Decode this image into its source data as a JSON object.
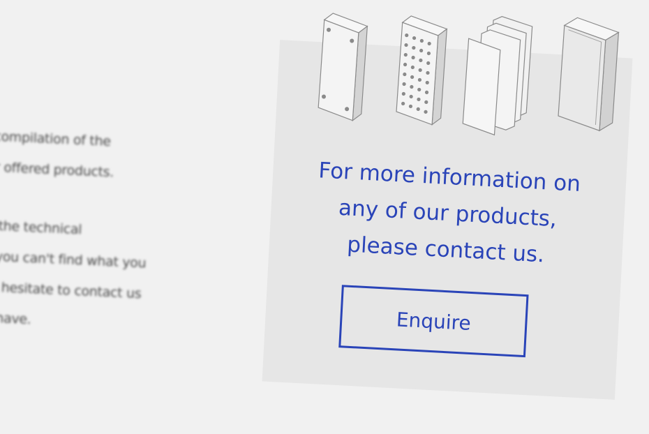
{
  "left_copy": {
    "lines": [
      "s a compilation of the",
      "f our offered products.",
      "n all the technical",
      "er if you can't find what you",
      "don't hesitate to contact us",
      "may have."
    ]
  },
  "card": {
    "message_lines": [
      "For more information on",
      "any of our products,",
      "please contact us."
    ],
    "button_label": "Enquire",
    "accent_color": "#2a44b8",
    "icons": [
      "panel-with-corner-holes-icon",
      "perforated-panel-icon",
      "stacked-sheets-icon",
      "solid-block-icon"
    ]
  }
}
